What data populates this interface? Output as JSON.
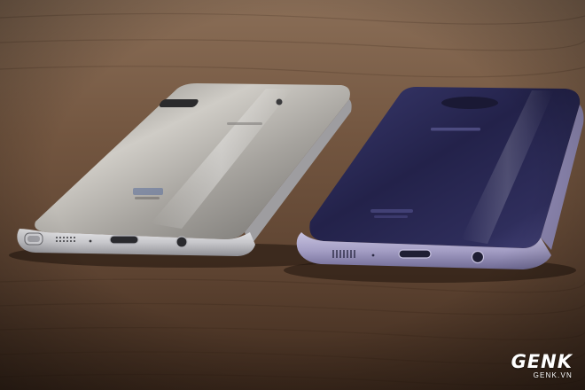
{
  "photo": {
    "scene": "two-smartphones-on-wooden-table",
    "colors": {
      "wood_top": "#8a6e57",
      "wood_mid": "#6b4f3a",
      "wood_bottom": "#3e2a1d",
      "silver_phone_body": "#b9b6b0",
      "silver_phone_frame": "#d4d4d8",
      "violet_phone_body": "#2d2c5a",
      "violet_phone_frame": "#a9a3c9"
    }
  },
  "phones": [
    {
      "id": "silver",
      "icons": [
        "home-button-icon",
        "speaker-grille-icon",
        "microphone-icon",
        "usb-c-port-icon",
        "headphone-jack-icon",
        "stylus-slot-icon"
      ]
    },
    {
      "id": "violet",
      "icons": [
        "speaker-grille-icon",
        "microphone-icon",
        "usb-c-port-icon",
        "headphone-jack-icon"
      ]
    }
  ],
  "watermark": {
    "logo_text": "GENK",
    "site_text": "GENK.VN"
  }
}
